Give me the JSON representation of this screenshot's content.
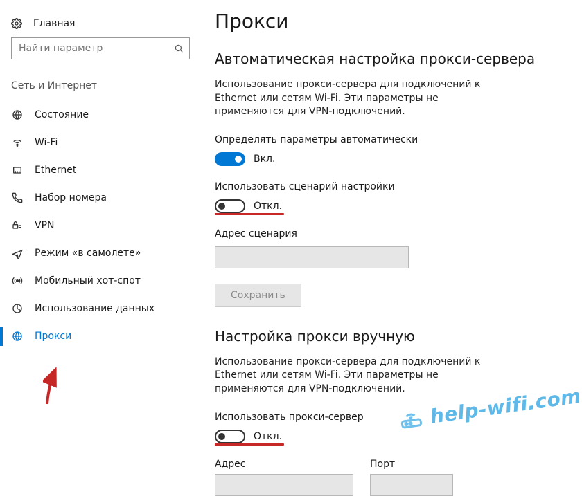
{
  "sidebar": {
    "home": "Главная",
    "search_placeholder": "Найти параметр",
    "section": "Сеть и Интернет",
    "items": [
      {
        "label": "Состояние"
      },
      {
        "label": "Wi-Fi"
      },
      {
        "label": "Ethernet"
      },
      {
        "label": "Набор номера"
      },
      {
        "label": "VPN"
      },
      {
        "label": "Режим «в самолете»"
      },
      {
        "label": "Мобильный хот-спот"
      },
      {
        "label": "Использование данных"
      },
      {
        "label": "Прокси"
      }
    ]
  },
  "main": {
    "title": "Прокси",
    "auto": {
      "heading": "Автоматическая настройка прокси-сервера",
      "desc": "Использование прокси-сервера для подключений к Ethernet или сетям Wi-Fi. Эти параметры не применяются для VPN-подключений.",
      "detect_label": "Определять параметры автоматически",
      "detect_state": "Вкл.",
      "script_label": "Использовать сценарий настройки",
      "script_state": "Откл.",
      "address_label": "Адрес сценария",
      "address_value": "",
      "save_label": "Сохранить"
    },
    "manual": {
      "heading": "Настройка прокси вручную",
      "desc": "Использование прокси-сервера для подключений к Ethernet или сетям Wi-Fi. Эти параметры не применяются для VPN-подключений.",
      "use_label": "Использовать прокси-сервер",
      "use_state": "Откл.",
      "address_label": "Адрес",
      "address_value": "",
      "port_label": "Порт",
      "port_value": ""
    }
  },
  "watermark": "help-wifi.com"
}
